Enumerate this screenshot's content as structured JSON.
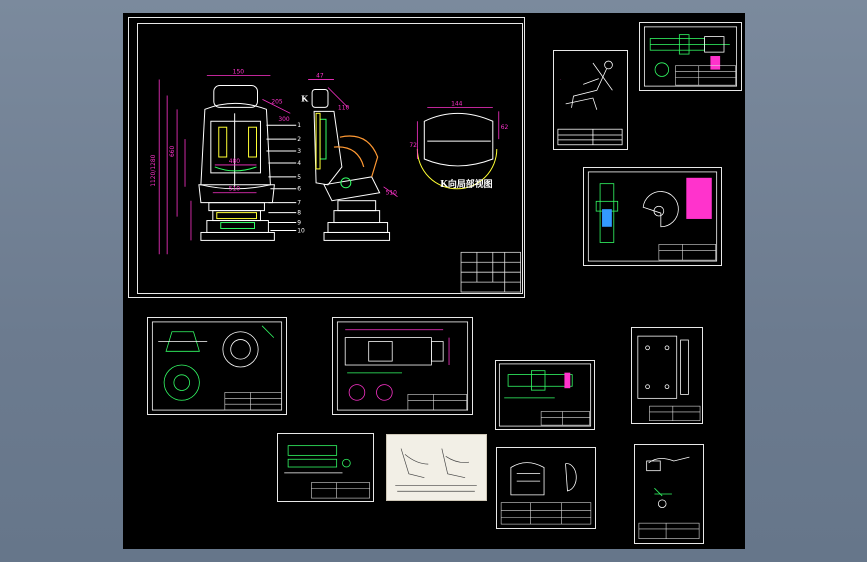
{
  "app": {
    "background": "#6f7f93",
    "canvas_background": "#000000"
  },
  "main_drawing": {
    "view_label": "K",
    "section_label": "K向局部视图",
    "dimension_color": "#ff33cc",
    "balloon_numbers": [
      "1",
      "2",
      "3",
      "4",
      "5",
      "6",
      "7",
      "8",
      "9",
      "10"
    ]
  },
  "sheets": [
    {
      "id": "main-assembly"
    },
    {
      "id": "posture-sketch"
    },
    {
      "id": "shaft-part"
    },
    {
      "id": "cam-part"
    },
    {
      "id": "flange-part"
    },
    {
      "id": "bracket-part"
    },
    {
      "id": "rail-part"
    },
    {
      "id": "plate-part"
    },
    {
      "id": "rod-part"
    },
    {
      "id": "ergonomic-photo"
    },
    {
      "id": "cushion-part"
    },
    {
      "id": "lever-part"
    }
  ]
}
